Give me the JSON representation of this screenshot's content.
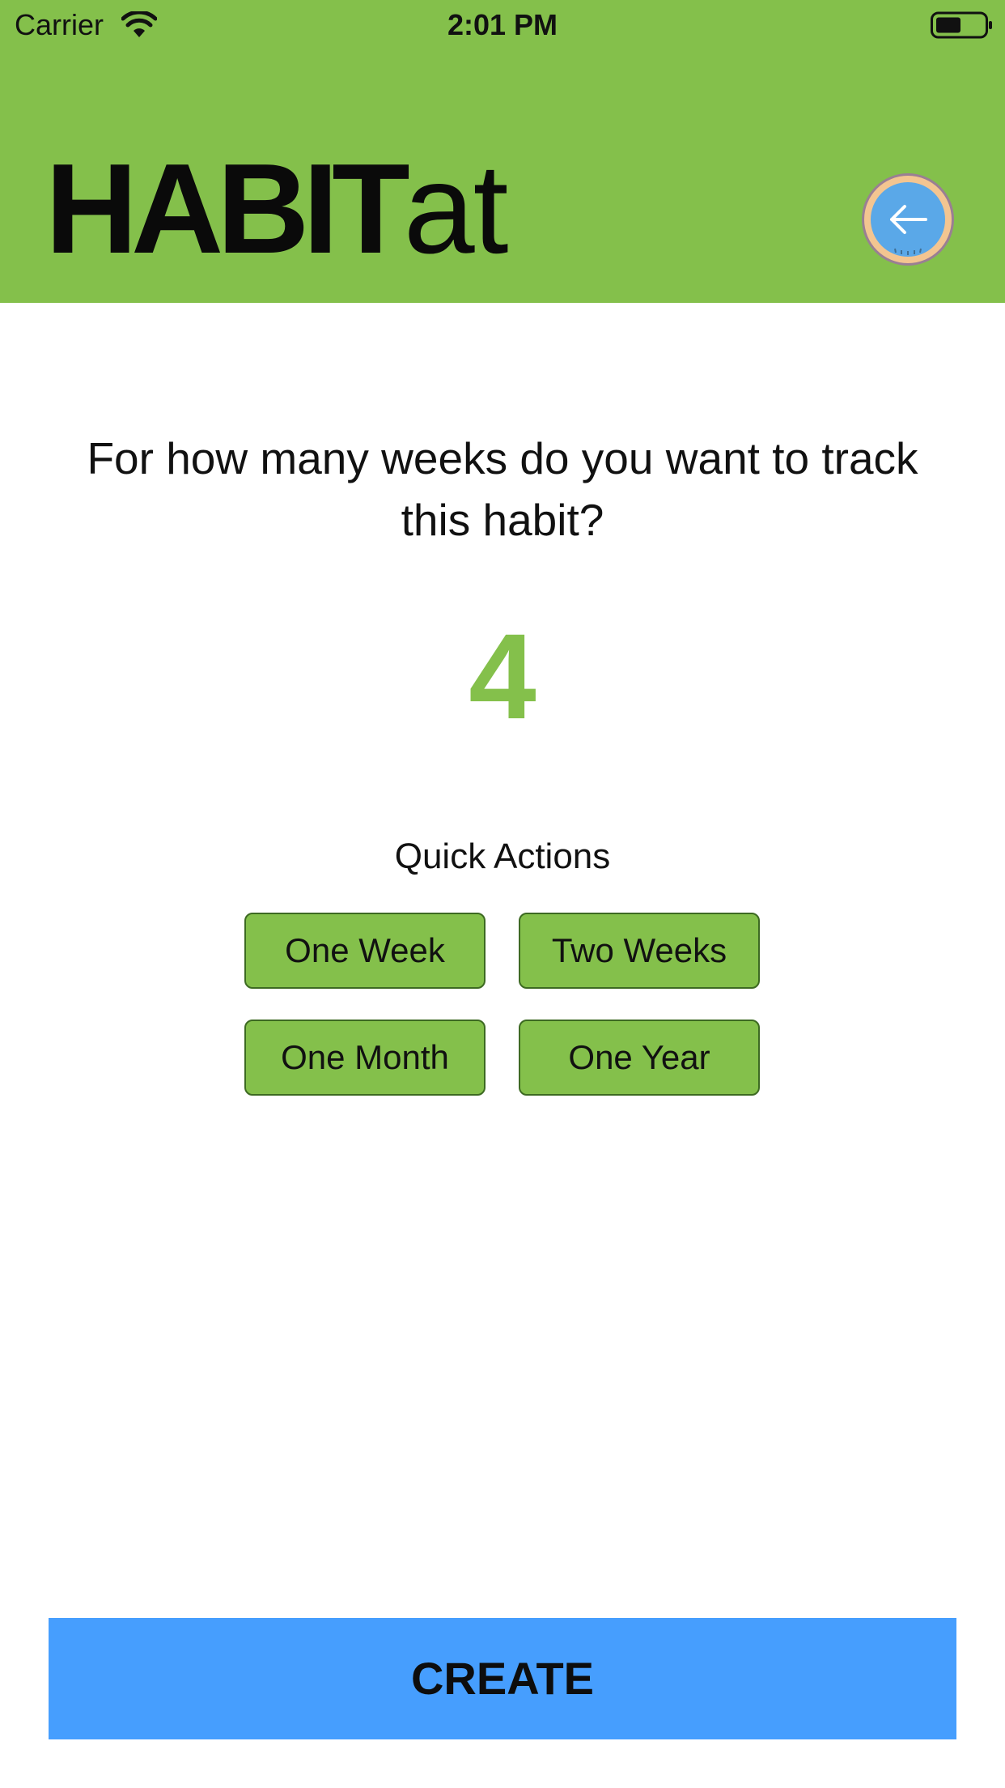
{
  "status_bar": {
    "carrier": "Carrier",
    "time": "2:01 PM",
    "wifi_icon": "wifi-icon",
    "battery_icon": "battery-icon"
  },
  "header": {
    "logo_bold": "HABIT",
    "logo_light": "at",
    "background_color": "#84c04b",
    "back_icon": "arrow-left-icon"
  },
  "main": {
    "question_line1": "For how many weeks do you want to track",
    "question_line2": "this habit?",
    "weeks_value": "4",
    "accent_color": "#84c04b",
    "quick_actions_title": "Quick Actions",
    "quick_actions": [
      "One Week",
      "Two Weeks",
      "One Month",
      "One Year"
    ]
  },
  "footer": {
    "create_label": "CREATE",
    "create_color": "#469efe"
  }
}
